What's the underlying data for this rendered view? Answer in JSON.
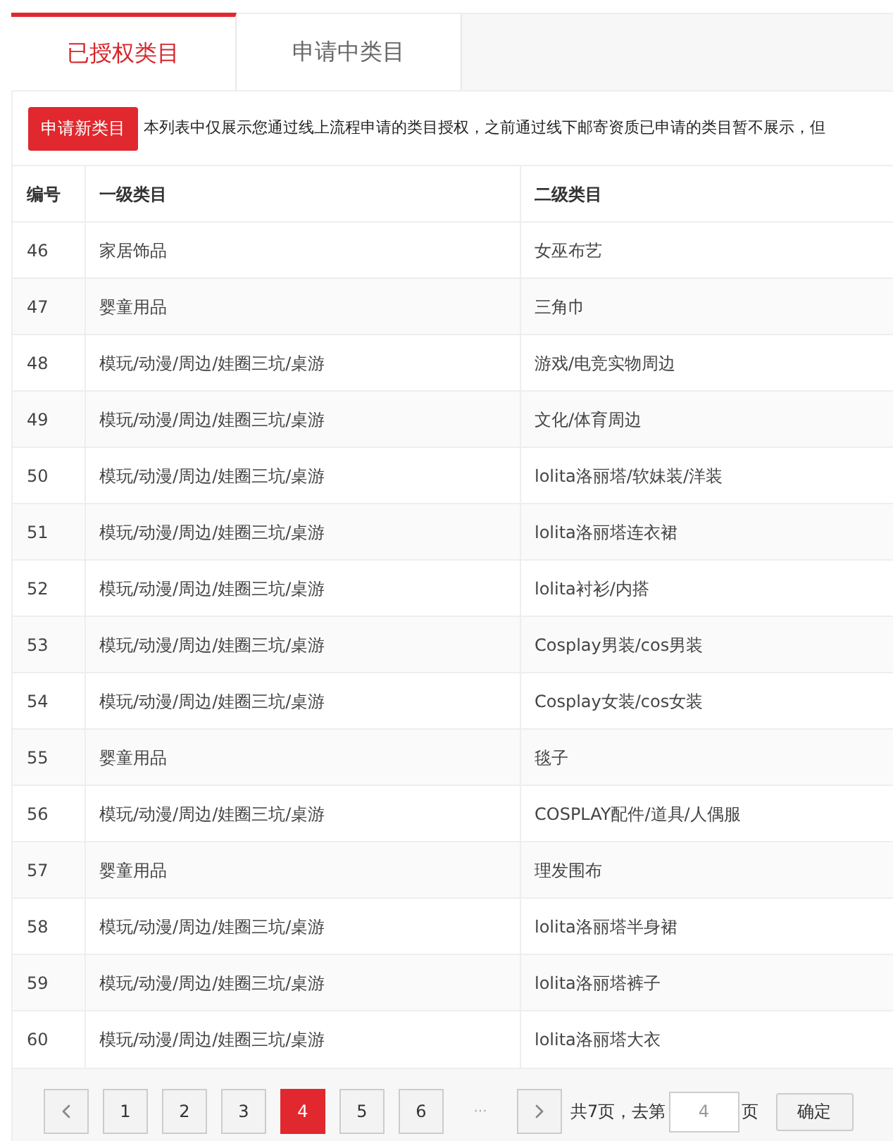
{
  "tabs": [
    {
      "label": "已授权类目",
      "selected": true
    },
    {
      "label": "申请中类目",
      "selected": false
    }
  ],
  "apply_button": "申请新类目",
  "notice": "本列表中仅展示您通过线上流程申请的类目授权，之前通过线下邮寄资质已申请的类目暂不展示，但",
  "table": {
    "columns": [
      "编号",
      "一级类目",
      "二级类目"
    ],
    "rows": [
      [
        "46",
        "家居饰品",
        "女巫布艺"
      ],
      [
        "47",
        "婴童用品",
        "三角巾"
      ],
      [
        "48",
        "模玩/动漫/周边/娃圈三坑/桌游",
        "游戏/电竞实物周边"
      ],
      [
        "49",
        "模玩/动漫/周边/娃圈三坑/桌游",
        "文化/体育周边"
      ],
      [
        "50",
        "模玩/动漫/周边/娃圈三坑/桌游",
        "lolita洛丽塔/软妹装/洋装"
      ],
      [
        "51",
        "模玩/动漫/周边/娃圈三坑/桌游",
        "lolita洛丽塔连衣裙"
      ],
      [
        "52",
        "模玩/动漫/周边/娃圈三坑/桌游",
        "lolita衬衫/内搭"
      ],
      [
        "53",
        "模玩/动漫/周边/娃圈三坑/桌游",
        "Cosplay男装/cos男装"
      ],
      [
        "54",
        "模玩/动漫/周边/娃圈三坑/桌游",
        "Cosplay女装/cos女装"
      ],
      [
        "55",
        "婴童用品",
        "毯子"
      ],
      [
        "56",
        "模玩/动漫/周边/娃圈三坑/桌游",
        "COSPLAY配件/道具/人偶服"
      ],
      [
        "57",
        "婴童用品",
        "理发围布"
      ],
      [
        "58",
        "模玩/动漫/周边/娃圈三坑/桌游",
        "lolita洛丽塔半身裙"
      ],
      [
        "59",
        "模玩/动漫/周边/娃圈三坑/桌游",
        "lolita洛丽塔裤子"
      ],
      [
        "60",
        "模玩/动漫/周边/娃圈三坑/桌游",
        "lolita洛丽塔大衣"
      ]
    ]
  },
  "pagination": {
    "pages": [
      {
        "label": "1",
        "selected": false
      },
      {
        "label": "2",
        "selected": false
      },
      {
        "label": "3",
        "selected": false
      },
      {
        "label": "4",
        "selected": true
      },
      {
        "label": "5",
        "selected": false
      },
      {
        "label": "6",
        "selected": false
      }
    ],
    "ellipsis": "···",
    "total": "共7页，去第",
    "page_input": {
      "placeholder": "4"
    },
    "suffix": "页",
    "confirm": "确定"
  }
}
